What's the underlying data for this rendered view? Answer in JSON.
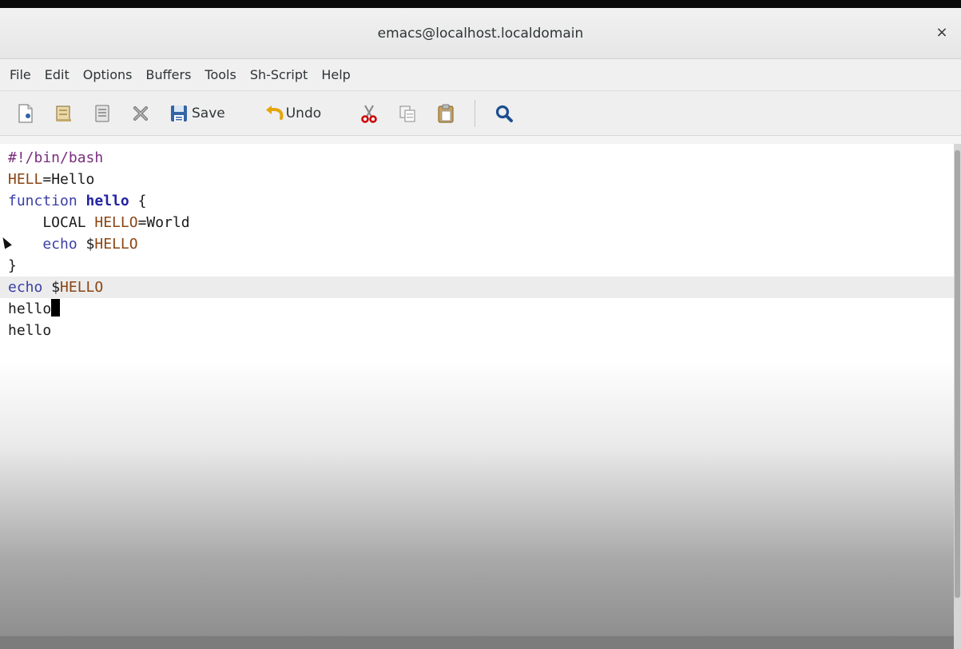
{
  "window": {
    "title": "emacs@localhost.localdomain",
    "close_label": "×"
  },
  "menubar": {
    "items": [
      "File",
      "Edit",
      "Options",
      "Buffers",
      "Tools",
      "Sh-Script",
      "Help"
    ]
  },
  "toolbar": {
    "save_label": "Save",
    "undo_label": "Undo",
    "icons": [
      "new-file-icon",
      "open-file-icon",
      "open-directory-icon",
      "close-buffer-icon",
      "save-icon",
      "undo-icon",
      "cut-icon",
      "copy-icon",
      "paste-icon",
      "search-icon"
    ]
  },
  "editor": {
    "lines": [
      {
        "segments": [
          {
            "text": "#!/bin/bash",
            "style": "comment"
          }
        ]
      },
      {
        "segments": [
          {
            "text": "HELL",
            "style": "var"
          },
          {
            "text": "=Hello",
            "style": "plain"
          }
        ]
      },
      {
        "segments": [
          {
            "text": "function ",
            "style": "kw"
          },
          {
            "text": "hello",
            "style": "fn"
          },
          {
            "text": " {",
            "style": "plain"
          }
        ]
      },
      {
        "segments": [
          {
            "text": "    LOCAL ",
            "style": "plain"
          },
          {
            "text": "HELLO",
            "style": "var"
          },
          {
            "text": "=World",
            "style": "plain"
          }
        ]
      },
      {
        "segments": [
          {
            "text": "    echo ",
            "style": "kw"
          },
          {
            "text": "$",
            "style": "plain"
          },
          {
            "text": "HELLO",
            "style": "var"
          }
        ]
      },
      {
        "segments": [
          {
            "text": "}",
            "style": "plain"
          }
        ]
      },
      {
        "segments": [
          {
            "text": "echo ",
            "style": "kw"
          },
          {
            "text": "$",
            "style": "plain"
          },
          {
            "text": "HELLO",
            "style": "var"
          }
        ],
        "current": true
      },
      {
        "segments": [
          {
            "text": "hello",
            "style": "plain"
          }
        ],
        "cursor": true
      },
      {
        "segments": [
          {
            "text": "hello",
            "style": "plain"
          }
        ]
      }
    ]
  },
  "colors": {
    "comment": "#7a2d7e",
    "variable": "#8b4513",
    "keyword": "#3a3fa6",
    "function_name": "#2323a3",
    "save_icon_blue": "#3465a4",
    "undo_arrow": "#e5a50a",
    "cut_scissors": "#cc0000",
    "search_icon": "#1c4f8f"
  }
}
